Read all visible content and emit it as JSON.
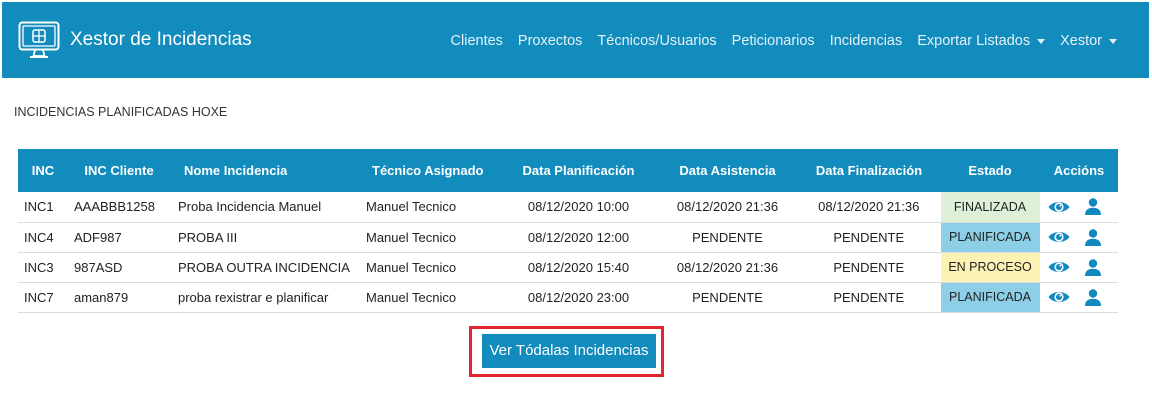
{
  "colors": {
    "primary": "#128bbd",
    "highlight": "#e3262d",
    "icon": "#1188c0"
  },
  "navbar": {
    "brand_icon": "monitor-icon",
    "brand": "Xestor de Incidencias",
    "items": [
      {
        "label": "Clientes",
        "dropdown": false
      },
      {
        "label": "Proxectos",
        "dropdown": false
      },
      {
        "label": "Técnicos/Usuarios",
        "dropdown": false
      },
      {
        "label": "Peticionarios",
        "dropdown": false
      },
      {
        "label": "Incidencias",
        "dropdown": false
      },
      {
        "label": "Exportar Listados",
        "dropdown": true
      },
      {
        "label": "Xestor",
        "dropdown": true
      }
    ]
  },
  "section_title": "INCIDENCIAS PLANIFICADAS HOXE",
  "table": {
    "headers": [
      "INC",
      "INC Cliente",
      "Nome Incidencia",
      "Técnico Asignado",
      "Data Planificación",
      "Data Asistencia",
      "Data Finalización",
      "Estado",
      "Accións"
    ],
    "action_icons": [
      "eye-icon",
      "user-icon"
    ],
    "rows": [
      {
        "inc": "INC1",
        "inc_cliente": "AAABBB1258",
        "nome": "Proba Incidencia Manuel",
        "tecnico": "Manuel Tecnico",
        "data_planificacion": "08/12/2020 10:00",
        "data_asistencia": "08/12/2020 21:36",
        "data_finalizacion": "08/12/2020 21:36",
        "estado": "FINALIZADA",
        "estado_color": "#dff0d8"
      },
      {
        "inc": "INC4",
        "inc_cliente": "ADF987",
        "nome": "PROBA III",
        "tecnico": "Manuel Tecnico",
        "data_planificacion": "08/12/2020 12:00",
        "data_asistencia": "PENDENTE",
        "data_finalizacion": "PENDENTE",
        "estado": "PLANIFICADA",
        "estado_color": "#8ccfe6"
      },
      {
        "inc": "INC3",
        "inc_cliente": "987ASD",
        "nome": "PROBA OUTRA INCIDENCIA",
        "tecnico": "Manuel Tecnico",
        "data_planificacion": "08/12/2020 15:40",
        "data_asistencia": "08/12/2020 21:36",
        "data_finalizacion": "PENDENTE",
        "estado": "EN PROCESO",
        "estado_color": "#fcf2b4"
      },
      {
        "inc": "INC7",
        "inc_cliente": "aman879",
        "nome": "proba rexistrar e planificar",
        "tecnico": "Manuel Tecnico",
        "data_planificacion": "08/12/2020 23:00",
        "data_asistencia": "PENDENTE",
        "data_finalizacion": "PENDENTE",
        "estado": "PLANIFICADA",
        "estado_color": "#8ccfe6"
      }
    ]
  },
  "button": {
    "label": "Ver Tódalas Incidencias"
  }
}
